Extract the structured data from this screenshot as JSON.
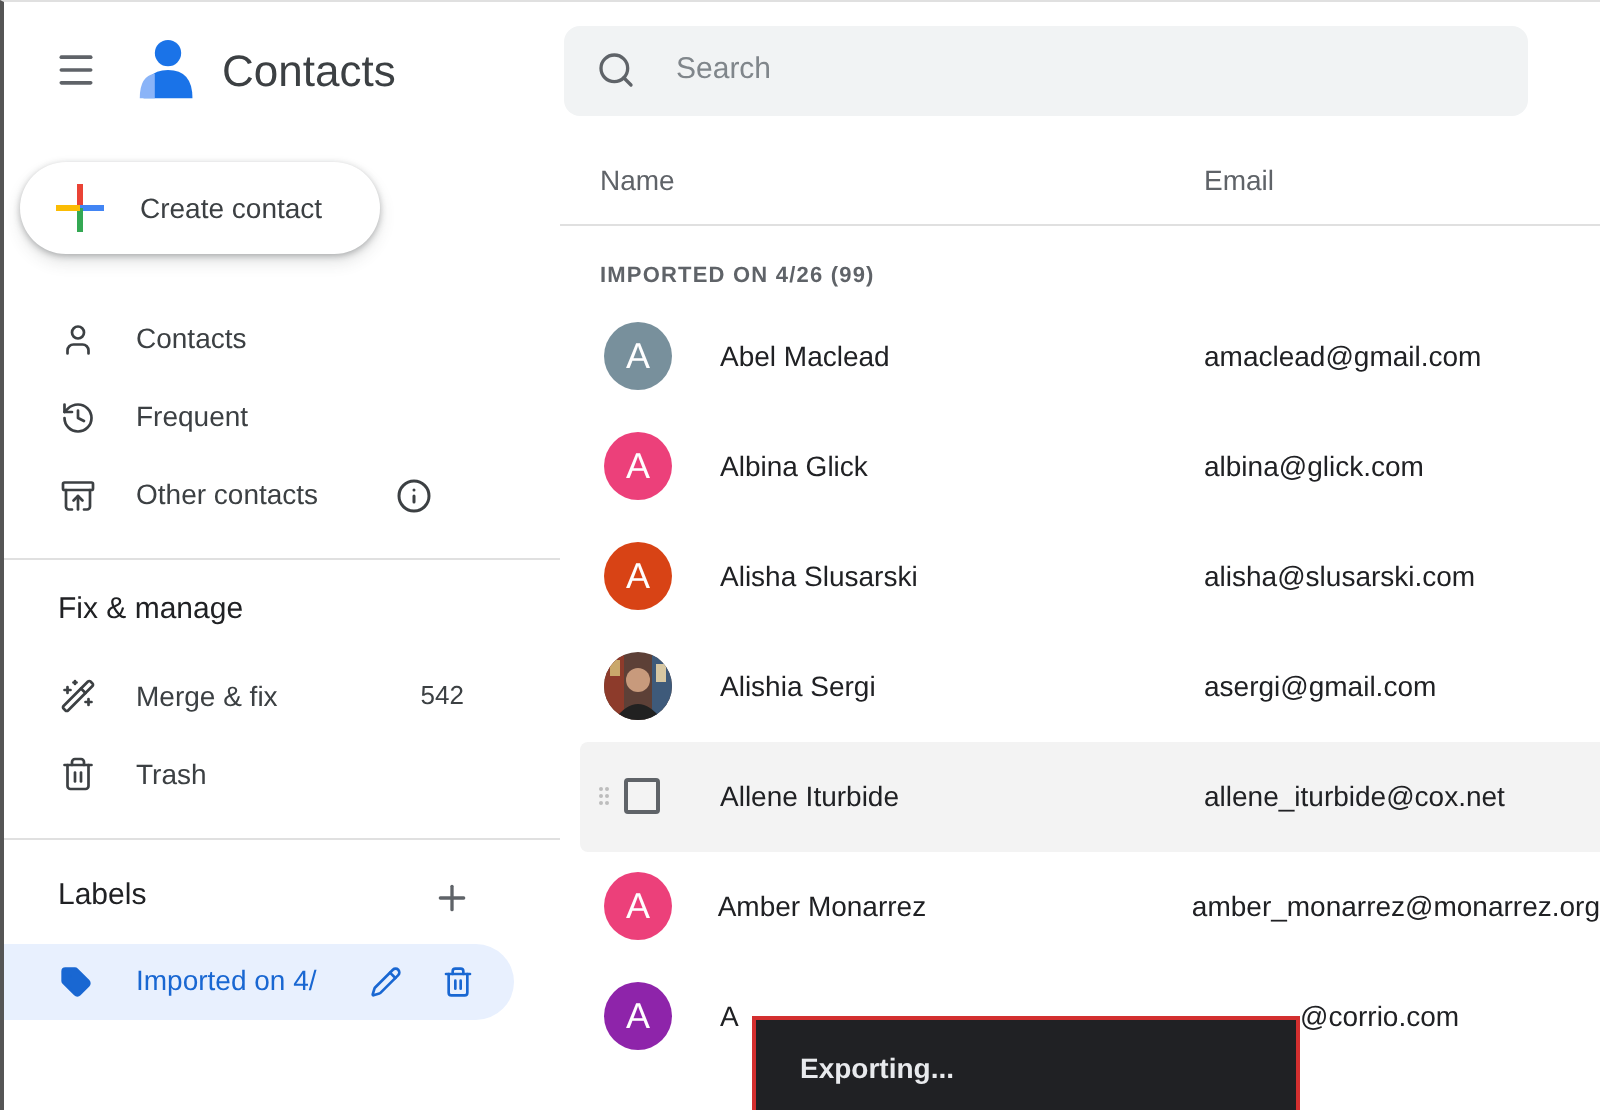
{
  "app": {
    "title": "Contacts"
  },
  "search": {
    "placeholder": "Search"
  },
  "create_button": {
    "label": "Create contact"
  },
  "nav": [
    {
      "label": "Contacts",
      "kind": "person",
      "selected": false,
      "info": false
    },
    {
      "label": "Frequent",
      "kind": "history",
      "selected": false,
      "info": false
    },
    {
      "label": "Other contacts",
      "kind": "archive",
      "selected": false,
      "info": true
    }
  ],
  "fix_manage": {
    "title": "Fix & manage",
    "items": [
      {
        "label": "Merge & fix",
        "kind": "wand",
        "count": "542"
      },
      {
        "label": "Trash",
        "kind": "trash"
      }
    ]
  },
  "labels": {
    "title": "Labels",
    "items": [
      {
        "label": "Imported on 4/",
        "selected": true
      }
    ]
  },
  "table": {
    "columns": [
      "Name",
      "Email"
    ],
    "section": "IMPORTED ON 4/26 (99)",
    "rows": [
      {
        "kind": "letter",
        "letter": "A",
        "color": "#78909c",
        "name": "Abel Maclead",
        "email": "amaclead@gmail.com",
        "hovered": false
      },
      {
        "kind": "letter",
        "letter": "A",
        "color": "#ec407a",
        "name": "Albina Glick",
        "email": "albina@glick.com",
        "hovered": false
      },
      {
        "kind": "letter",
        "letter": "A",
        "color": "#d84315",
        "name": "Alisha Slusarski",
        "email": "alisha@slusarski.com",
        "hovered": false
      },
      {
        "name": "Alishia Sergi",
        "email": "asergi@gmail.com",
        "hovered": false
      },
      {
        "checked": false,
        "name": "Allene Iturbide",
        "email": "allene_iturbide@cox.net",
        "hovered": true
      },
      {
        "kind": "letter",
        "letter": "A",
        "color": "#ec407a",
        "name": "Amber Monarrez",
        "email": "amber_monarrez@monarrez.org",
        "hovered": false
      },
      {
        "kind": "letter",
        "letter": "A",
        "color": "#8e24aa",
        "name": "A",
        "email": "@corrio.com",
        "hovered": false,
        "under_toast": true
      }
    ]
  },
  "toast": {
    "text": "Exporting..."
  }
}
